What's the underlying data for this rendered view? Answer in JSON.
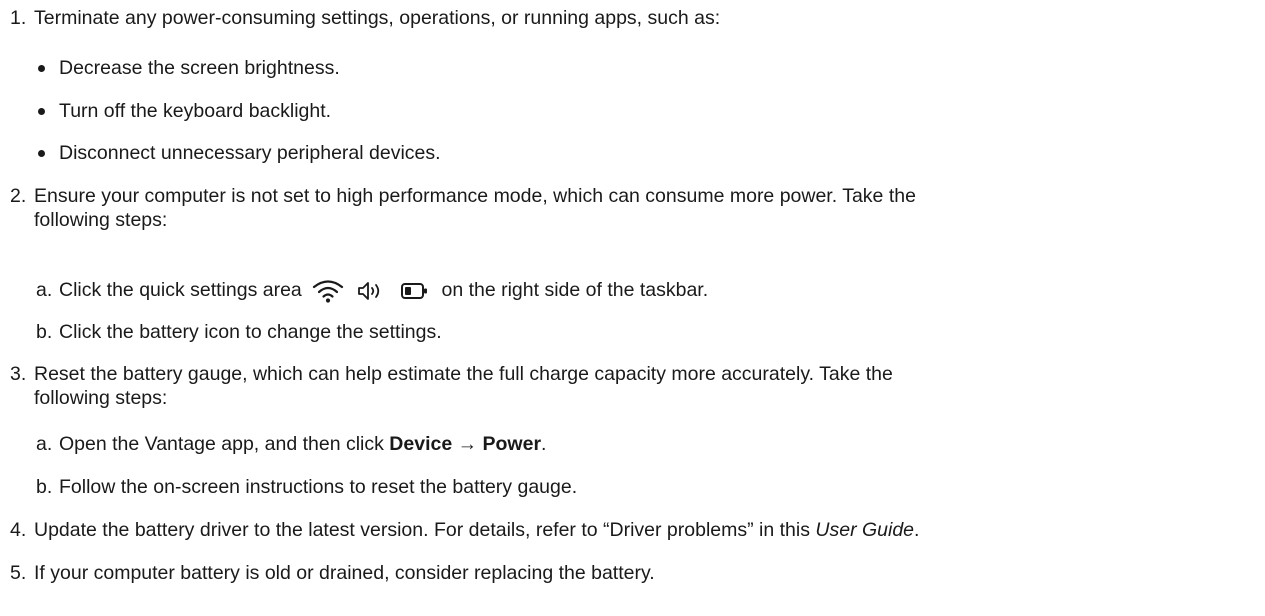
{
  "steps": [
    {
      "number": "1.",
      "text": "Terminate any power-consuming settings, operations, or running apps, such as:",
      "bullets": [
        "Decrease the screen brightness.",
        "Turn off the keyboard backlight.",
        "Disconnect unnecessary peripheral devices."
      ]
    },
    {
      "number": "2.",
      "text_line1": "Ensure your computer is not set to high performance mode, which can consume more power. Take the",
      "text_line2": "following steps:",
      "substeps": [
        {
          "letter": "a.",
          "text_before": "Click the quick settings area",
          "icons": [
            "wifi-icon",
            "speaker-icon",
            "battery-icon"
          ],
          "text_after": "on the right side of the taskbar."
        },
        {
          "letter": "b.",
          "text": "Click the battery icon to change the settings."
        }
      ]
    },
    {
      "number": "3.",
      "text_line1": "Reset the battery gauge, which can help estimate the full charge capacity more accurately. Take the",
      "text_line2": "following steps:",
      "substeps": [
        {
          "letter": "a.",
          "text_before": "Open the Vantage app, and then click ",
          "bold": "Device → Power",
          "text_after": "."
        },
        {
          "letter": "b.",
          "text": "Follow the on-screen instructions to reset the battery gauge."
        }
      ]
    },
    {
      "number": "4.",
      "text_before": "Update the battery driver to the latest version. For details, refer to “Driver problems” in this ",
      "italic": "User Guide",
      "text_after": "."
    },
    {
      "number": "5.",
      "text": "If your computer battery is old or drained, consider replacing the battery."
    }
  ]
}
